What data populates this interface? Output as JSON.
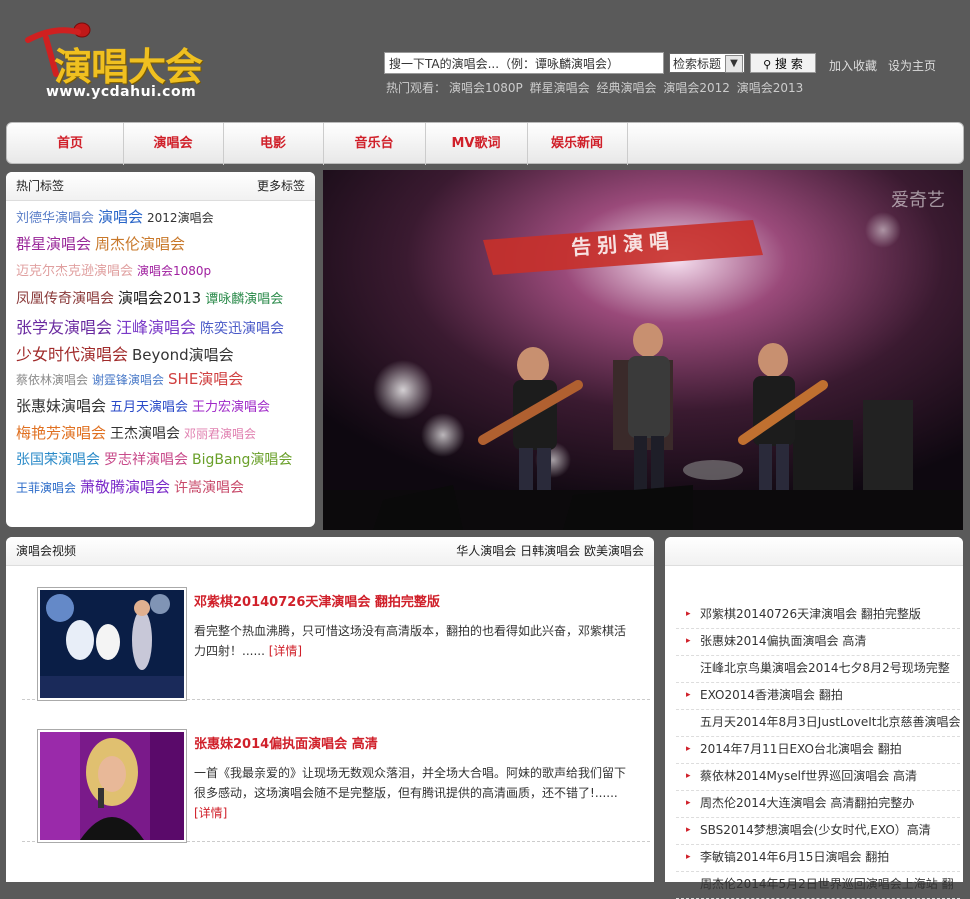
{
  "header": {
    "logo_cn": "演唱大会",
    "logo_url": "www.ycdahui.com",
    "search_value": "搜一下TA的演唱会...（例：谭咏麟演唱会）",
    "search_scope": "检索标题",
    "search_button": "搜  索",
    "add_favorite": "加入收藏",
    "set_homepage": "设为主页",
    "hot_label": "热门观看：",
    "hot_links": [
      "演唱会1080P",
      "群星演唱会",
      "经典演唱会",
      "演唱会2012",
      "演唱会2013"
    ]
  },
  "nav": [
    "首页",
    "演唱会",
    "电影",
    "音乐台",
    "MV歌词",
    "娱乐新闻"
  ],
  "tags_panel": {
    "title": "热门标签",
    "more": "更多标签",
    "lines": [
      [
        {
          "t": "刘德华演唱会",
          "c": "#5a7ec8",
          "s": 13
        },
        {
          "t": "演唱会",
          "c": "#2a66c8",
          "s": 15
        },
        {
          "t": "2012演唱会",
          "c": "#333",
          "s": 12
        }
      ],
      [
        {
          "t": "群星演唱会",
          "c": "#9a2a9a",
          "s": 15
        },
        {
          "t": "周杰伦演唱会",
          "c": "#c8782a",
          "s": 15
        }
      ],
      [
        {
          "t": "迈克尔杰克逊演唱会",
          "c": "#e0a0a0",
          "s": 13
        },
        {
          "t": "演唱会1080p",
          "c": "#a020a0",
          "s": 12
        }
      ],
      [
        {
          "t": "凤凰传奇演唱会",
          "c": "#8a3a3a",
          "s": 14
        },
        {
          "t": "演唱会2013",
          "c": "#222",
          "s": 15
        },
        {
          "t": "谭咏麟演唱会",
          "c": "#2a8a4a",
          "s": 13
        }
      ],
      [
        {
          "t": "张学友演唱会",
          "c": "#6a2aa0",
          "s": 16
        },
        {
          "t": "汪峰演唱会",
          "c": "#7a3ac8",
          "s": 16
        },
        {
          "t": "陈奕迅演唱会",
          "c": "#4a5ac8",
          "s": 14
        }
      ],
      [
        {
          "t": "少女时代演唱会",
          "c": "#a02a2a",
          "s": 16
        },
        {
          "t": "Beyond演唱会",
          "c": "#333",
          "s": 15
        }
      ],
      [
        {
          "t": "蔡依林演唱会",
          "c": "#8a8a8a",
          "s": 12
        },
        {
          "t": "谢霆锋演唱会",
          "c": "#4a7ac8",
          "s": 12
        },
        {
          "t": "SHE演唱会",
          "c": "#d04040",
          "s": 15
        }
      ],
      [
        {
          "t": "张惠妹演唱会",
          "c": "#333",
          "s": 15
        },
        {
          "t": "五月天演唱会",
          "c": "#2a4ac8",
          "s": 13
        },
        {
          "t": "王力宏演唱会",
          "c": "#a02ac8",
          "s": 13
        }
      ],
      [
        {
          "t": "梅艳芳演唱会",
          "c": "#e07020",
          "s": 15
        },
        {
          "t": "王杰演唱会",
          "c": "#333",
          "s": 14
        },
        {
          "t": "邓丽君演唱会",
          "c": "#e080b0",
          "s": 12
        }
      ],
      [
        {
          "t": "张国荣演唱会",
          "c": "#2a8ac8",
          "s": 14
        },
        {
          "t": "罗志祥演唱会",
          "c": "#c84a8a",
          "s": 14
        },
        {
          "t": "BigBang演唱会",
          "c": "#6aa02a",
          "s": 14
        }
      ],
      [
        {
          "t": "王菲演唱会",
          "c": "#2a6ac8",
          "s": 12
        },
        {
          "t": "萧敬腾演唱会",
          "c": "#7a2ac8",
          "s": 15
        },
        {
          "t": "许嵩演唱会",
          "c": "#c84a6a",
          "s": 14
        }
      ]
    ]
  },
  "video": {
    "watermark": "爱奇艺",
    "banner_text": "告别演唱"
  },
  "videos_panel": {
    "title": "演唱会视频",
    "links": [
      "华人演唱会",
      "日韩演唱会",
      "欧美演唱会"
    ],
    "items": [
      {
        "title": "邓紫棋20140726天津演唱会 翻拍完整版",
        "desc": "看完整个热血沸腾，只可惜这场没有高清版本，翻拍的也看得如此兴奋，邓紫棋活力四射！......",
        "more": "[详情]"
      },
      {
        "title": "张惠妹2014偏执面演唱会 高清",
        "desc": "一首《我最亲爱的》让现场无数观众落泪，并全场大合唱。阿妹的歌声给我们留下很多感动，这场演唱会随不是完整版，但有腾讯提供的高清画质，还不错了!......",
        "more": "[详情]"
      }
    ]
  },
  "right_list": [
    {
      "t": "邓紫棋20140726天津演唱会 翻拍完整版",
      "dot": true
    },
    {
      "t": "张惠妹2014偏执面演唱会 高清",
      "dot": true
    },
    {
      "t": "汪峰北京鸟巢演唱会2014七夕8月2号现场完整",
      "dot": false
    },
    {
      "t": "EXO2014香港演唱会 翻拍",
      "dot": true
    },
    {
      "t": "五月天2014年8月3日JustLoveIt北京慈善演唱会",
      "dot": false
    },
    {
      "t": "2014年7月11日EXO台北演唱会 翻拍",
      "dot": true
    },
    {
      "t": "蔡依林2014Myself世界巡回演唱会 高清",
      "dot": true
    },
    {
      "t": "周杰伦2014大连演唱会 高清翻拍完整办",
      "dot": true
    },
    {
      "t": "SBS2014梦想演唱会(少女时代,EXO）高清",
      "dot": true
    },
    {
      "t": "李敏镐2014年6月15日演唱会 翻拍",
      "dot": true
    },
    {
      "t": "周杰伦2014年5月2日世界巡回演唱会上海站 翻",
      "dot": false
    }
  ],
  "colors": {
    "accent": "#d0202a",
    "page_bg": "#5a5a5a",
    "logo_gold": "#f0c020"
  }
}
